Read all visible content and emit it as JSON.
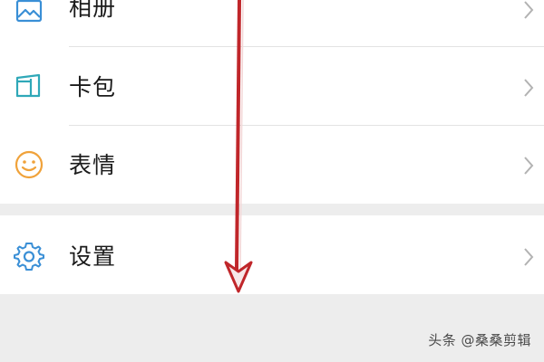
{
  "menu": {
    "items": [
      {
        "label": "相册",
        "icon": "album-icon"
      },
      {
        "label": "卡包",
        "icon": "card-wallet-icon"
      },
      {
        "label": "表情",
        "icon": "smiley-icon"
      },
      {
        "label": "设置",
        "icon": "gear-icon"
      }
    ]
  },
  "annotation": {
    "arrow": "down-arrow",
    "color": "#c0262a"
  },
  "watermark": {
    "text": "头条 @桑桑剪辑"
  },
  "colors": {
    "background": "#ededed",
    "row_background": "#ffffff",
    "icon_blue": "#3a8fd6",
    "icon_orange": "#f0a23a",
    "chevron": "#b2b2b2"
  }
}
